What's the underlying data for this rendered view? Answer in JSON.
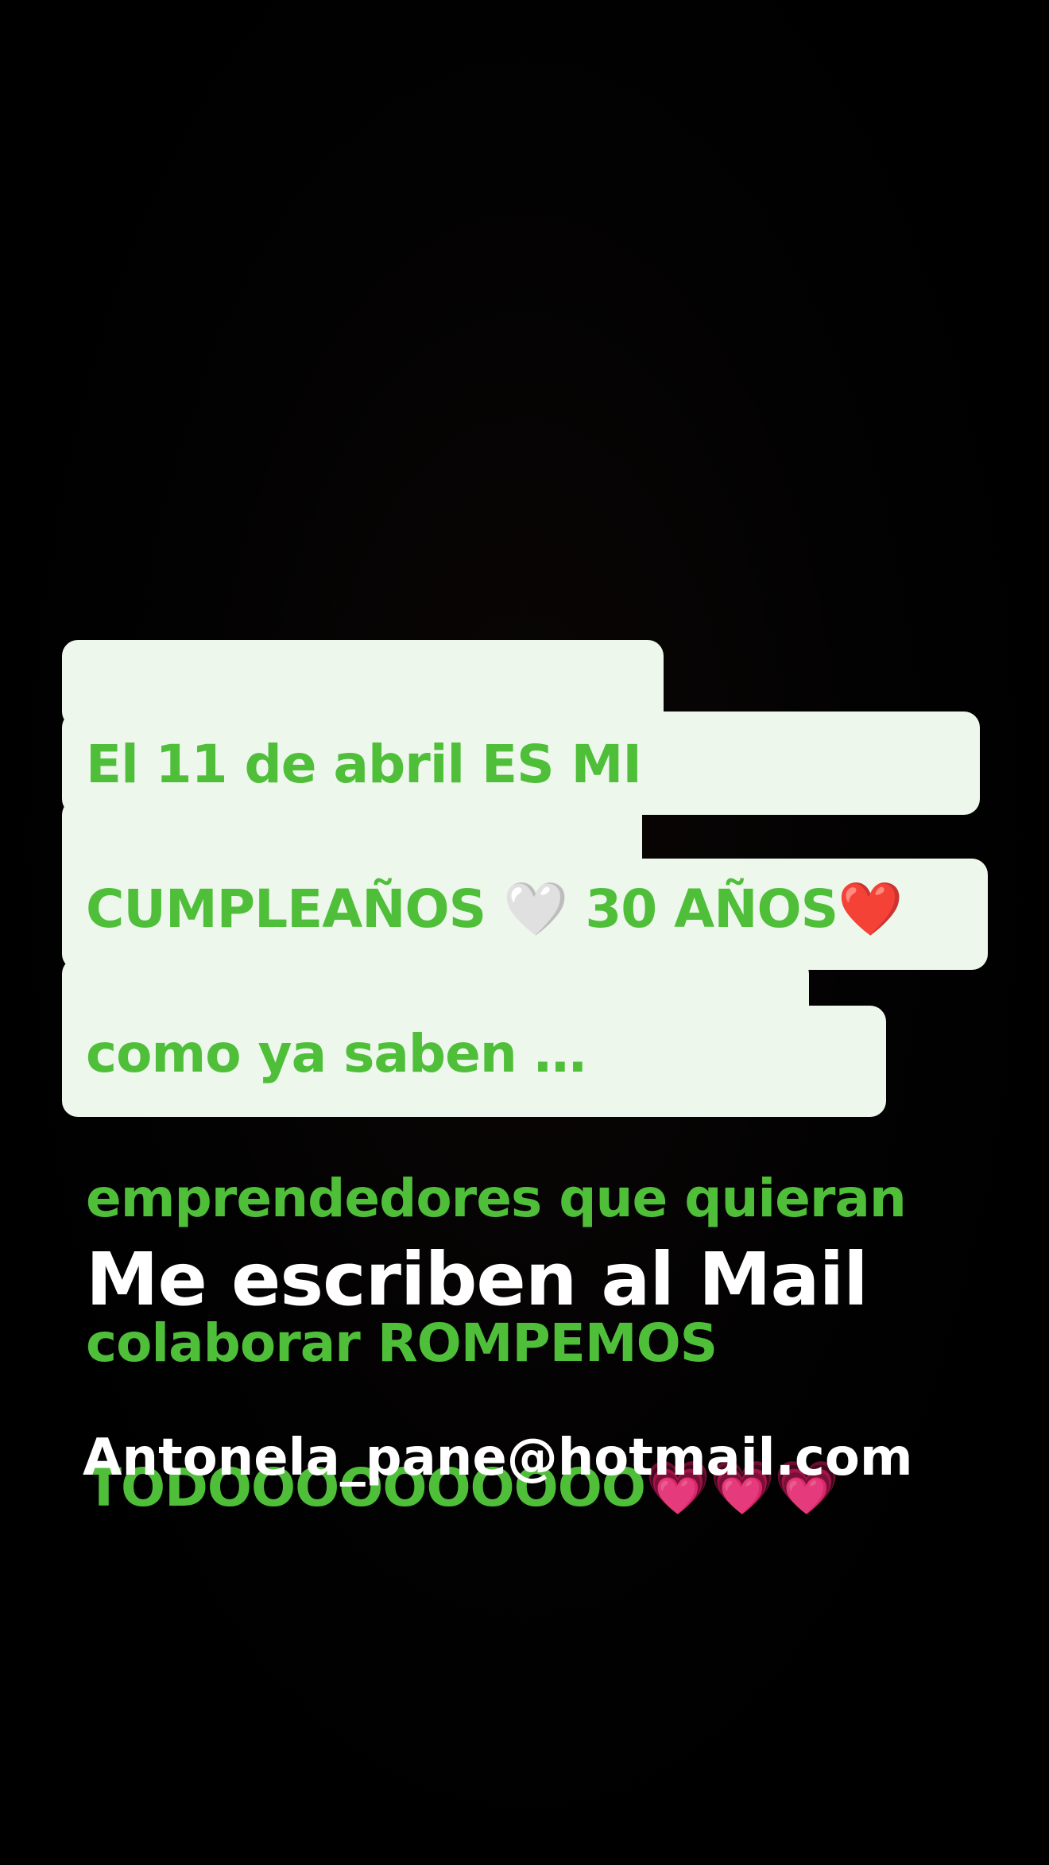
{
  "story": {
    "bubble": {
      "line1": "El 11 de abril ES MI",
      "line2_text": "CUMPLEAÑOS ",
      "line2_heart1": "🤍",
      "line2_text2": " 30 AÑOS",
      "line2_heart2": "❤️",
      "line3": "como ya saben …",
      "line4": "emprendedores que quieran",
      "line5": "colaborar ROMPEMOS",
      "line6_text": "TODOOOOOOOOOO",
      "line6_hearts": "💗💗💗"
    },
    "headline": "Me escriben al Mail",
    "email": "Antonela_pane@hotmail.com"
  },
  "colors": {
    "background": "#000000",
    "bubble_bg": "#eef7ec",
    "bubble_text": "#4fbf3a",
    "caption_text": "#ffffff"
  }
}
